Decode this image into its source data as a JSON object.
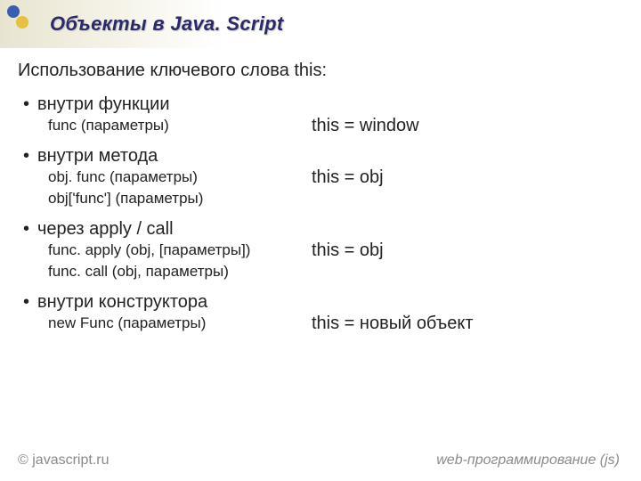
{
  "header": {
    "title": "Объекты в Java. Script"
  },
  "main": {
    "subtitle": "Использование ключевого слова this:",
    "items": [
      {
        "heading": "внутри функции",
        "subs": [
          "func (параметры)"
        ],
        "result": "this = window"
      },
      {
        "heading": "внутри метода",
        "subs": [
          "obj. func (параметры)",
          "obj['func'] (параметры)"
        ],
        "result": "this = obj"
      },
      {
        "heading": "через apply / call",
        "subs": [
          "func. apply (obj, [параметры])",
          "func. call (obj, параметры)"
        ],
        "result": "this = obj"
      },
      {
        "heading": "внутри конструктора",
        "subs": [
          "new Func (параметры)"
        ],
        "result": "this = новый объект"
      }
    ]
  },
  "footer": {
    "copyright": "© javascript.ru",
    "tagline": "web-программирование (js)"
  }
}
